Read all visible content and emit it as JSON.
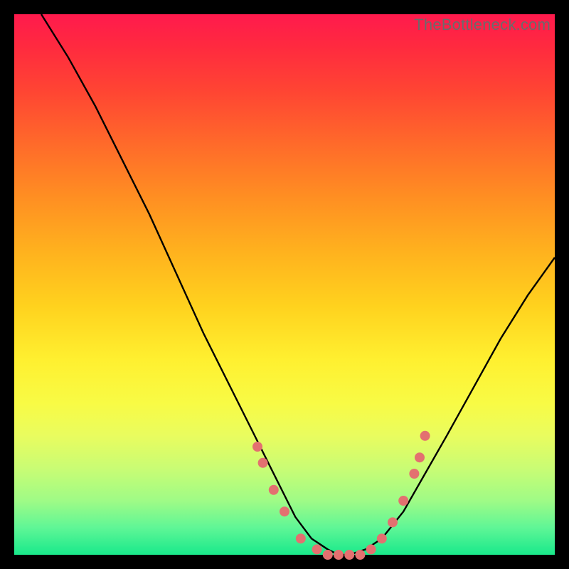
{
  "watermark": "TheBottleneck.com",
  "colors": {
    "curve": "#000000",
    "dots": "#e37070",
    "bg_top": "#ff1a4d",
    "bg_bottom": "#19e98b",
    "page": "#000000"
  },
  "chart_data": {
    "type": "line",
    "title": "",
    "xlabel": "",
    "ylabel": "",
    "xlim": [
      0,
      100
    ],
    "ylim": [
      0,
      100
    ],
    "series": [
      {
        "name": "bottleneck-curve",
        "x": [
          5,
          10,
          15,
          20,
          25,
          30,
          35,
          40,
          45,
          50,
          52,
          55,
          58,
          60,
          62,
          65,
          68,
          72,
          76,
          80,
          85,
          90,
          95,
          100
        ],
        "y": [
          100,
          92,
          83,
          73,
          63,
          52,
          41,
          31,
          21,
          11,
          7,
          3,
          1,
          0,
          0,
          1,
          3,
          8,
          15,
          22,
          31,
          40,
          48,
          55
        ]
      }
    ],
    "markers": {
      "name": "highlight-dots",
      "x": [
        45,
        46,
        48,
        50,
        53,
        56,
        58,
        60,
        62,
        64,
        66,
        68,
        70,
        72,
        74,
        75,
        76
      ],
      "y": [
        20,
        17,
        12,
        8,
        3,
        1,
        0,
        0,
        0,
        0,
        1,
        3,
        6,
        10,
        15,
        18,
        22
      ]
    }
  }
}
